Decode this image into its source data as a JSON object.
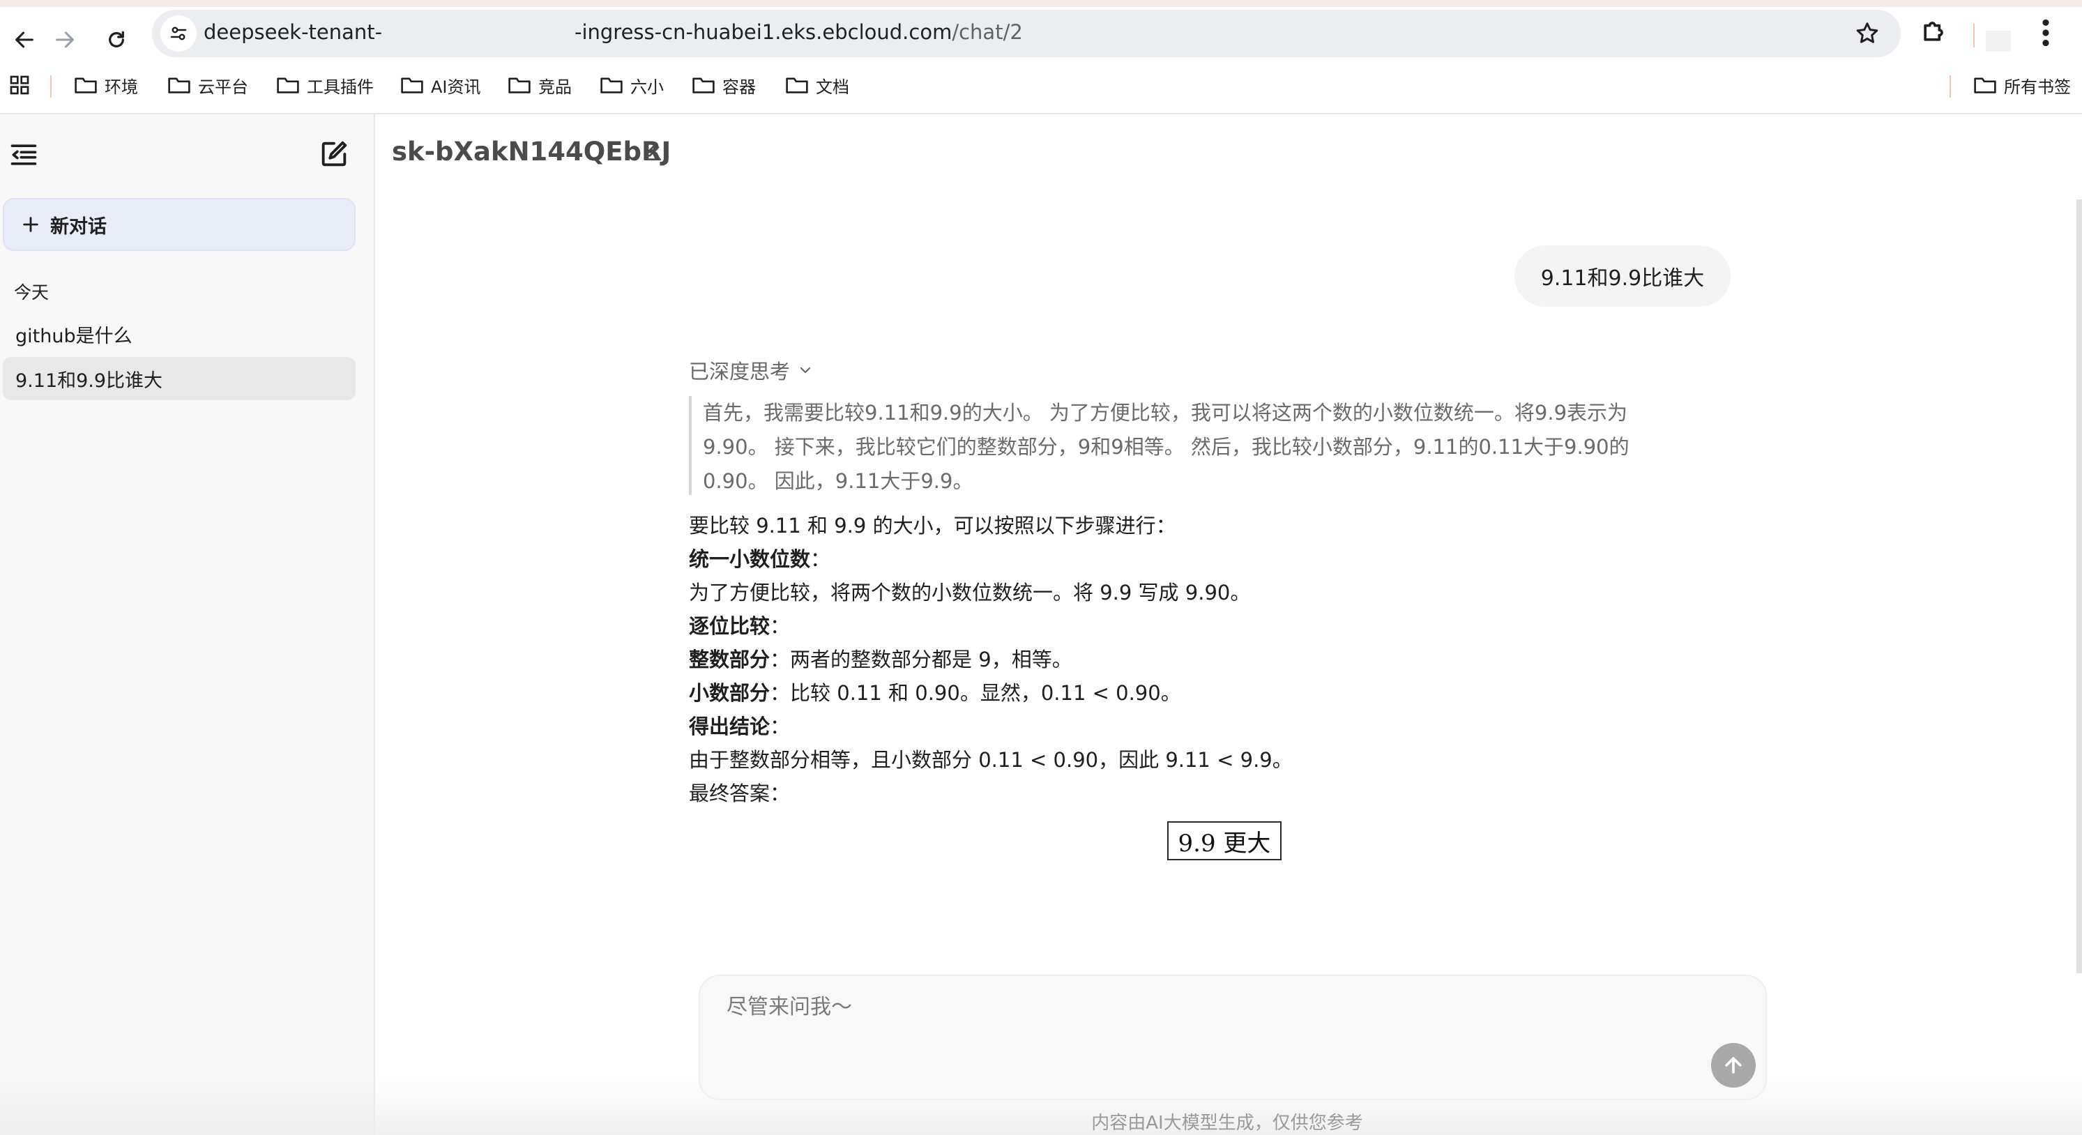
{
  "browser": {
    "url_host_start": "deepseek-tenant-",
    "url_host_end": "-ingress-cn-huabei1.eks.ebcloud.com",
    "url_path": "/chat/2",
    "bookmarks": [
      "环境",
      "云平台",
      "工具插件",
      "AI资讯",
      "竞品",
      "六小",
      "容器",
      "文档"
    ],
    "all_bookmarks_label": "所有书签"
  },
  "sidebar": {
    "new_chat_label": "新对话",
    "section_today": "今天",
    "conversations": [
      "github是什么",
      "9.11和9.9比谁大"
    ],
    "active_index": 1
  },
  "chat": {
    "title": "sk-bXakN144QEbRJ",
    "user_message": "9.11和9.9比谁大",
    "thinking_label": "已深度思考",
    "thinking_lines": [
      "首先，我需要比较9.11和9.9的大小。 为了方便比较，我可以将这两个数的小数位数统一。将9.9表示为",
      "9.90。 接下来，我比较它们的整数部分，9和9相等。 然后，我比较小数部分，9.11的0.11大于9.90的",
      "0.90。 因此，9.11大于9.9。"
    ],
    "answer": {
      "intro": "要比较 9.11 和 9.9 的大小，可以按照以下步骤进行：",
      "step1_title": "统一小数位数",
      "step1_text": "为了方便比较，将两个数的小数位数统一。将 9.9 写成 9.90。",
      "step2_title": "逐位比较",
      "int_label": "整数部分",
      "int_text": "两者的整数部分都是 9，相等。",
      "dec_label": "小数部分",
      "dec_text": "比较 0.11 和 0.90。显然，0.11 < 0.90。",
      "step3_title": "得出结论",
      "conclusion_text": "由于整数部分相等，且小数部分 0.11 < 0.90，因此 9.11 < 9.9。",
      "final_label": "最终答案",
      "colon": "：",
      "final_boxed": "9.9 更大"
    }
  },
  "input": {
    "placeholder": "尽管来问我～",
    "disclaimer": "内容由AI大模型生成，仅供您参考"
  }
}
